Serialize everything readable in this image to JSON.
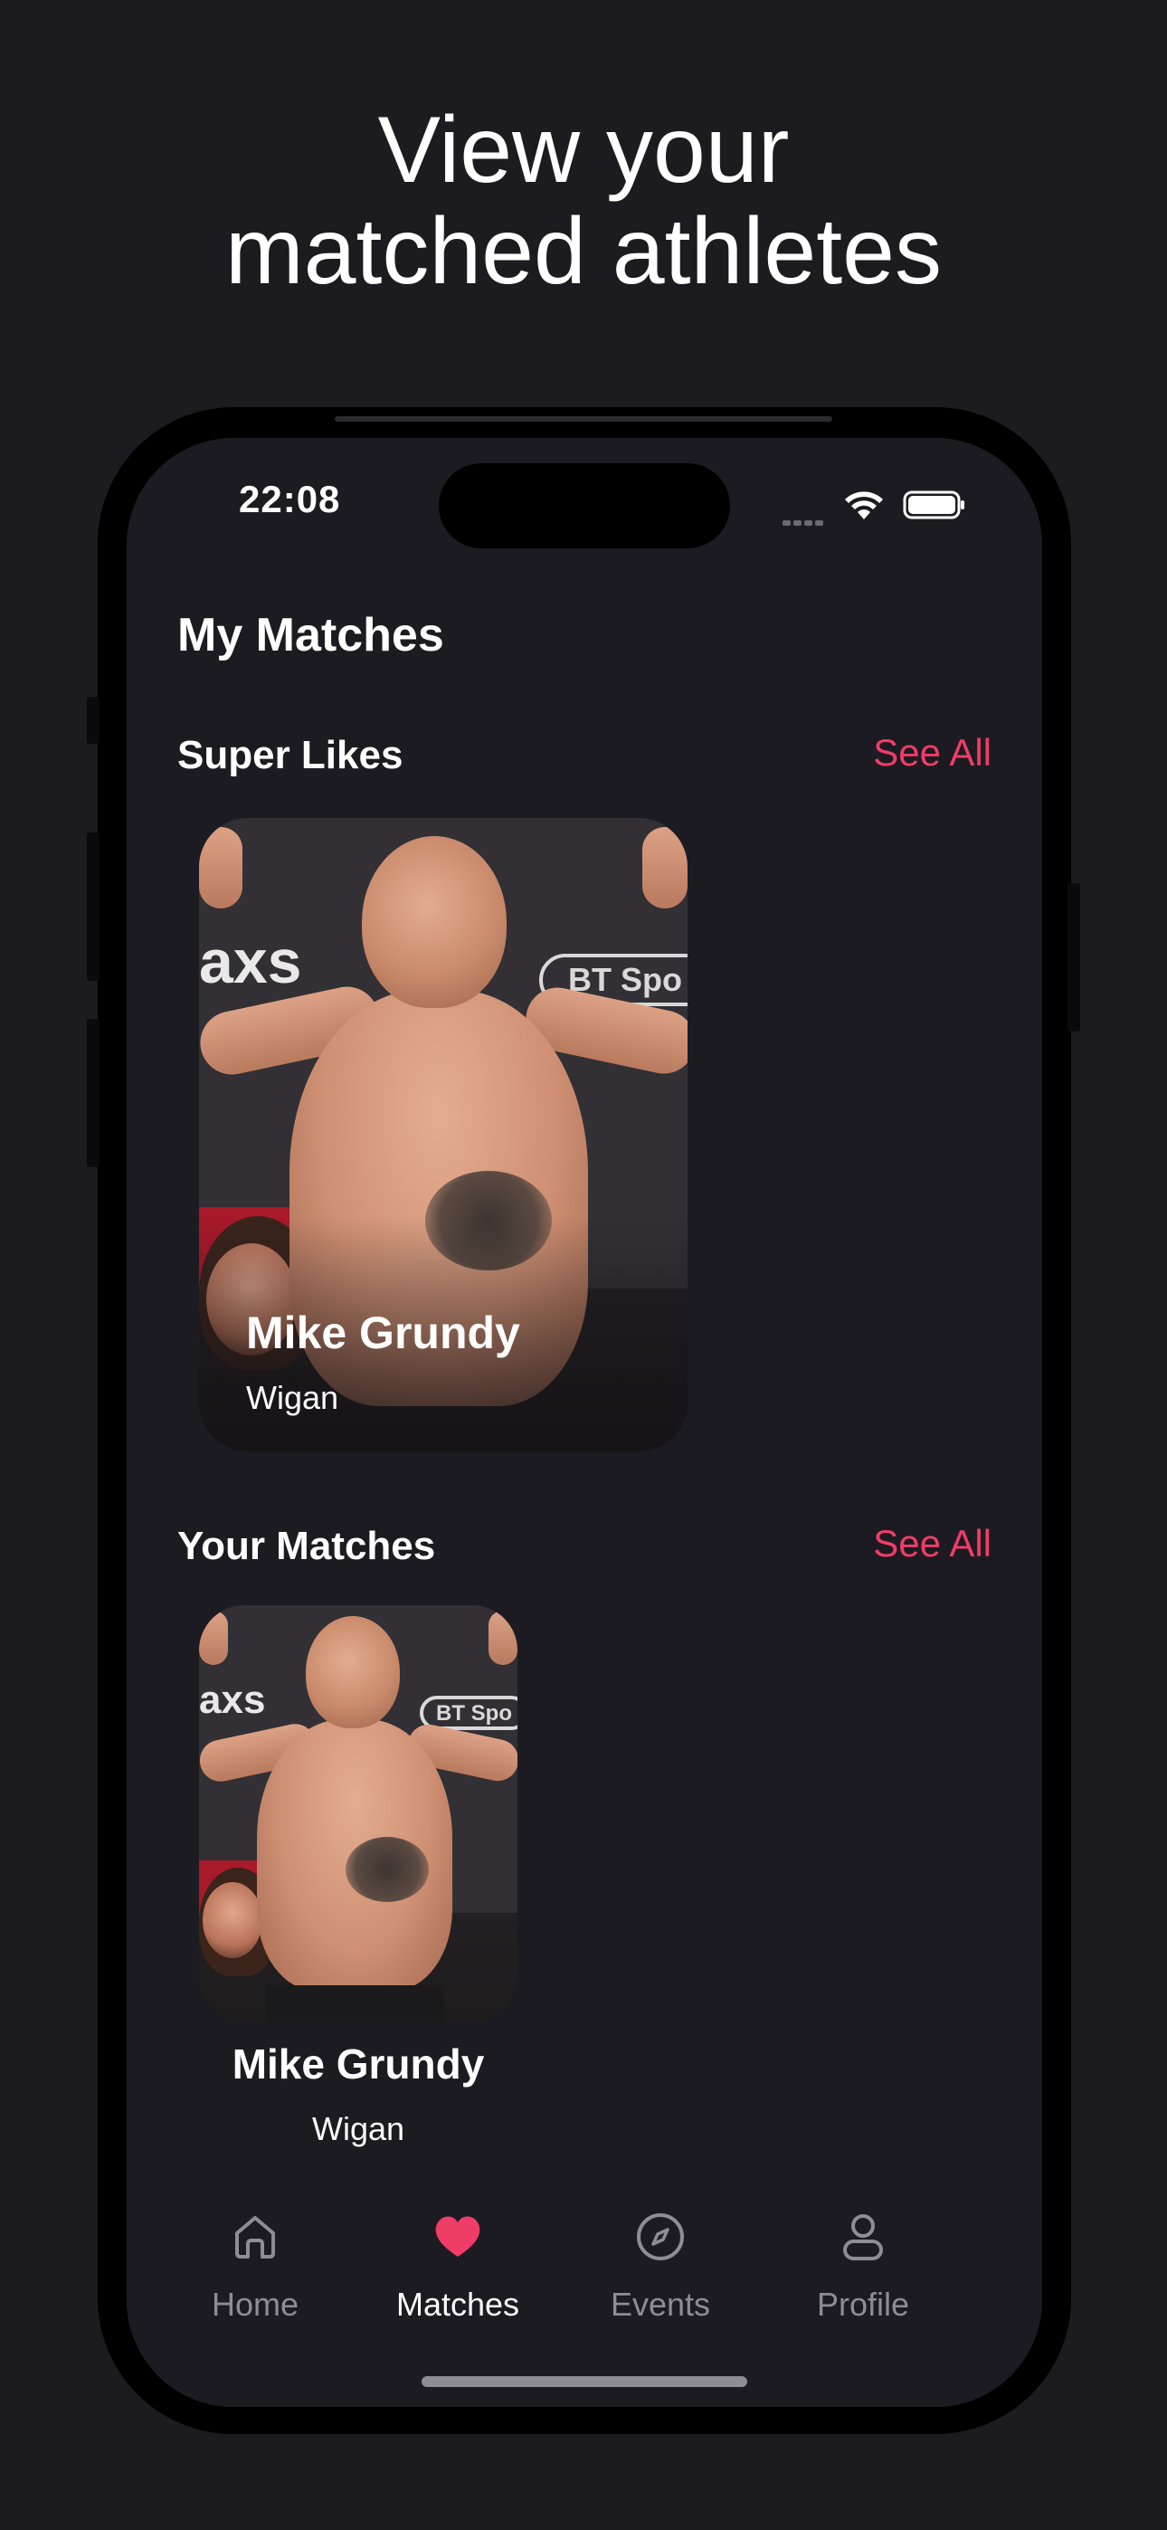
{
  "headline": {
    "line1": "View your",
    "line2": "matched athletes"
  },
  "status_bar": {
    "time": "22:08",
    "icons": [
      "signal-dots-icon",
      "wifi-icon",
      "battery-icon"
    ]
  },
  "page": {
    "title": "My Matches"
  },
  "super_likes": {
    "title": "Super Likes",
    "see_all": "See All",
    "cards": [
      {
        "name": "Mike Grundy",
        "city": "Wigan"
      }
    ]
  },
  "your_matches": {
    "title": "Your Matches",
    "see_all": "See All",
    "cards": [
      {
        "name": "Mike Grundy",
        "city": "Wigan"
      }
    ]
  },
  "photo_background": {
    "brand_logo": "axs",
    "sponsor_logo": "BT Spo"
  },
  "tabbar": {
    "tabs": [
      {
        "label": "Home",
        "icon": "home-icon",
        "active": false
      },
      {
        "label": "Matches",
        "icon": "heart-icon",
        "active": true
      },
      {
        "label": "Events",
        "icon": "compass-icon",
        "active": false
      },
      {
        "label": "Profile",
        "icon": "user-icon",
        "active": false
      }
    ]
  },
  "colors": {
    "accent": "#ef3d67",
    "background": "#1c1b20",
    "screen": "#1c1b21",
    "inactive_tab": "#8e8d93"
  }
}
